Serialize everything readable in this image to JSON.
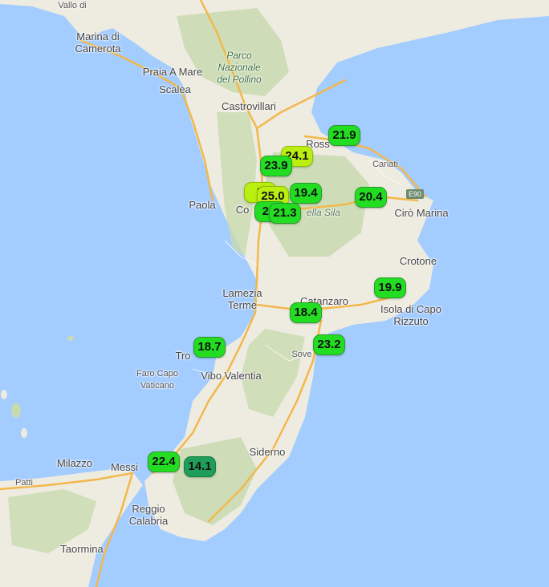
{
  "colors": {
    "sea": "#a3ccff",
    "land": "#eeebe0",
    "forest": "#c8dbb0",
    "road": "#f2b84b",
    "marker_green": "#22dd22",
    "marker_yellow": "#bbee11",
    "marker_dark": "#1e9e5a"
  },
  "places": {
    "marina_di_camerota": "Marina di\nCamerota",
    "valle_di": "Vallo di",
    "praia_a_mare": "Praia A Mare",
    "scalea": "Scalea",
    "parco_pollino": "Parco\nNazionale\ndel Pollino",
    "castrovillari": "Castrovillari",
    "rossano": "Ross",
    "cariati": "Cariati",
    "paola": "Paola",
    "cosenza": "Co",
    "sila": "ella Sila",
    "ciro_marina": "Cirò Marina",
    "crotone": "Crotone",
    "lamezia_terme": "Lamezia\nTerme",
    "catanzaro": "Catanzaro",
    "isola_capo_rizzuto": "Isola di Capo\nRizzuto",
    "soverato": "Sove",
    "tropea": "Tro",
    "vibo_valentia": "Vibo Valentia",
    "faro_capo_vaticano": "Faro Capo\nVaticano",
    "milazzo": "Milazzo",
    "messina": "Messi",
    "siderno": "Siderno",
    "patti": "Patti",
    "reggio_calabria": "Reggio\nCalabria",
    "taormina": "Taormina",
    "road_e90": "E90"
  },
  "markers": [
    {
      "id": "m-rossano",
      "value": "21.9",
      "color": "green"
    },
    {
      "id": "m-sila-yellow",
      "value": "24.1",
      "color": "yellow"
    },
    {
      "id": "m-cosenza-north",
      "value": "23.9",
      "color": "green"
    },
    {
      "id": "m-cosenza-stack-yellow",
      "value": "2",
      "color": "yellow"
    },
    {
      "id": "m-cosenza-stack-a",
      "value": "25.0",
      "color": "yellow"
    },
    {
      "id": "m-cosenza-stack-b",
      "value": "22.",
      "color": "green"
    },
    {
      "id": "m-sila-east",
      "value": "19.4",
      "color": "green"
    },
    {
      "id": "m-cosenza-south",
      "value": "21.3",
      "color": "green"
    },
    {
      "id": "m-ciro",
      "value": "20.4",
      "color": "green"
    },
    {
      "id": "m-capo-rizzuto",
      "value": "19.9",
      "color": "green"
    },
    {
      "id": "m-catanzaro",
      "value": "18.4",
      "color": "green"
    },
    {
      "id": "m-soverato",
      "value": "23.2",
      "color": "green"
    },
    {
      "id": "m-tropea",
      "value": "18.7",
      "color": "green"
    },
    {
      "id": "m-messina",
      "value": "22.4",
      "color": "green"
    },
    {
      "id": "m-aspromonte",
      "value": "14.1",
      "color": "dark"
    }
  ]
}
